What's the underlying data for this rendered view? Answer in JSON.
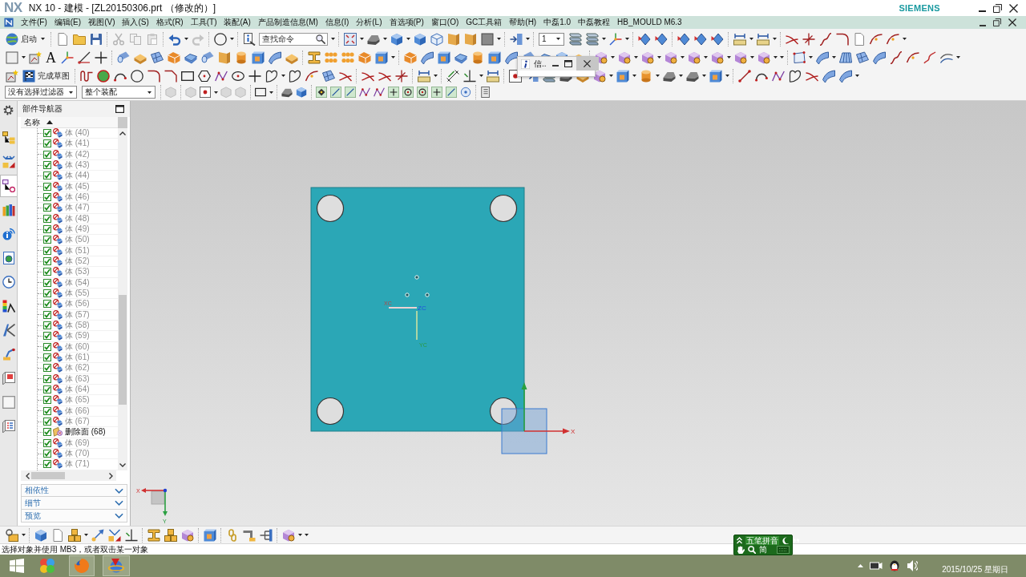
{
  "window": {
    "logo": "NX",
    "title": "NX 10 - 建模 - [ZL20150306.prt （修改的）]",
    "brand": "SIEMENS"
  },
  "menu_bar": {
    "items": [
      "文件(F)",
      "编辑(E)",
      "视图(V)",
      "插入(S)",
      "格式(R)",
      "工具(T)",
      "装配(A)",
      "产品制造信息(M)",
      "信息(I)",
      "分析(L)",
      "首选项(P)",
      "窗口(O)",
      "GC工具箱",
      "帮助(H)",
      "中磊1.0",
      "中磊教程",
      "HB_MOULD M6.3"
    ]
  },
  "toolbar": {
    "start_label": "启动",
    "search": {
      "placeholder": "查找命令"
    },
    "layer": "1",
    "text_tool": "A",
    "finish_sketch_label": "完成草图"
  },
  "selection_bar": {
    "filter": "没有选择过滤器",
    "scope": "整个装配"
  },
  "info_window": {
    "title": "信.."
  },
  "resource_bar": {
    "tabs": [
      {
        "selected": false
      },
      {
        "selected": false
      },
      {
        "selected": true
      },
      {
        "selected": false
      },
      {
        "selected": false
      },
      {
        "selected": false
      },
      {
        "selected": false
      },
      {
        "selected": false
      },
      {
        "selected": false
      },
      {
        "selected": false
      },
      {
        "selected": false
      },
      {
        "selected": false
      },
      {
        "selected": false
      }
    ]
  },
  "part_navigator": {
    "title": "部件导航器",
    "column": "名称",
    "rows": [
      {
        "kind": "body",
        "label": "体 (40)",
        "checked": true,
        "dimmed": true
      },
      {
        "kind": "body",
        "label": "体 (41)",
        "checked": true,
        "dimmed": true
      },
      {
        "kind": "body",
        "label": "体 (42)",
        "checked": true,
        "dimmed": true
      },
      {
        "kind": "body",
        "label": "体 (43)",
        "checked": true,
        "dimmed": true
      },
      {
        "kind": "body",
        "label": "体 (44)",
        "checked": true,
        "dimmed": true
      },
      {
        "kind": "body",
        "label": "体 (45)",
        "checked": true,
        "dimmed": true
      },
      {
        "kind": "body",
        "label": "体 (46)",
        "checked": true,
        "dimmed": true
      },
      {
        "kind": "body",
        "label": "体 (47)",
        "checked": true,
        "dimmed": true
      },
      {
        "kind": "body",
        "label": "体 (48)",
        "checked": true,
        "dimmed": true
      },
      {
        "kind": "body",
        "label": "体 (49)",
        "checked": true,
        "dimmed": true
      },
      {
        "kind": "body",
        "label": "体 (50)",
        "checked": true,
        "dimmed": true
      },
      {
        "kind": "body",
        "label": "体 (51)",
        "checked": true,
        "dimmed": true
      },
      {
        "kind": "body",
        "label": "体 (52)",
        "checked": true,
        "dimmed": true
      },
      {
        "kind": "body",
        "label": "体 (53)",
        "checked": true,
        "dimmed": true
      },
      {
        "kind": "body",
        "label": "体 (54)",
        "checked": true,
        "dimmed": true
      },
      {
        "kind": "body",
        "label": "体 (55)",
        "checked": true,
        "dimmed": true
      },
      {
        "kind": "body",
        "label": "体 (56)",
        "checked": true,
        "dimmed": true
      },
      {
        "kind": "body",
        "label": "体 (57)",
        "checked": true,
        "dimmed": true
      },
      {
        "kind": "body",
        "label": "体 (58)",
        "checked": true,
        "dimmed": true
      },
      {
        "kind": "body",
        "label": "体 (59)",
        "checked": true,
        "dimmed": true
      },
      {
        "kind": "body",
        "label": "体 (60)",
        "checked": true,
        "dimmed": true
      },
      {
        "kind": "body",
        "label": "体 (61)",
        "checked": true,
        "dimmed": true
      },
      {
        "kind": "body",
        "label": "体 (62)",
        "checked": true,
        "dimmed": true
      },
      {
        "kind": "body",
        "label": "体 (63)",
        "checked": true,
        "dimmed": true
      },
      {
        "kind": "body",
        "label": "体 (64)",
        "checked": true,
        "dimmed": true
      },
      {
        "kind": "body",
        "label": "体 (65)",
        "checked": true,
        "dimmed": true
      },
      {
        "kind": "body",
        "label": "体 (66)",
        "checked": true,
        "dimmed": true
      },
      {
        "kind": "body",
        "label": "体 (67)",
        "checked": true,
        "dimmed": true
      },
      {
        "kind": "delete_face",
        "label": "删除面 (68)",
        "checked": true,
        "dimmed": false
      },
      {
        "kind": "body",
        "label": "体 (69)",
        "checked": true,
        "dimmed": true
      },
      {
        "kind": "body",
        "label": "体 (70)",
        "checked": true,
        "dimmed": true
      },
      {
        "kind": "body",
        "label": "体 (71)",
        "checked": true,
        "dimmed": true
      }
    ],
    "panels": [
      {
        "label": "相依性",
        "expanded": false
      },
      {
        "label": "细节",
        "expanded": false
      },
      {
        "label": "预览",
        "expanded": false
      }
    ]
  },
  "viewport": {
    "wcs": {
      "x_label": "XC",
      "y_label": "YC",
      "z_label": "ZC"
    },
    "datum": {
      "x_label": "X"
    },
    "triad": {
      "x_label": "X",
      "y_label": "Y"
    }
  },
  "status_bar": {
    "message": "选择对象并使用 MB3，或者双击某一对象"
  },
  "ime_bar": {
    "mode": "五笔拼音",
    "script": "简"
  },
  "taskbar": {
    "apps": [
      {
        "running": false
      },
      {
        "running": true
      },
      {
        "running": true
      }
    ],
    "date": "2015/10/25 星期日"
  }
}
